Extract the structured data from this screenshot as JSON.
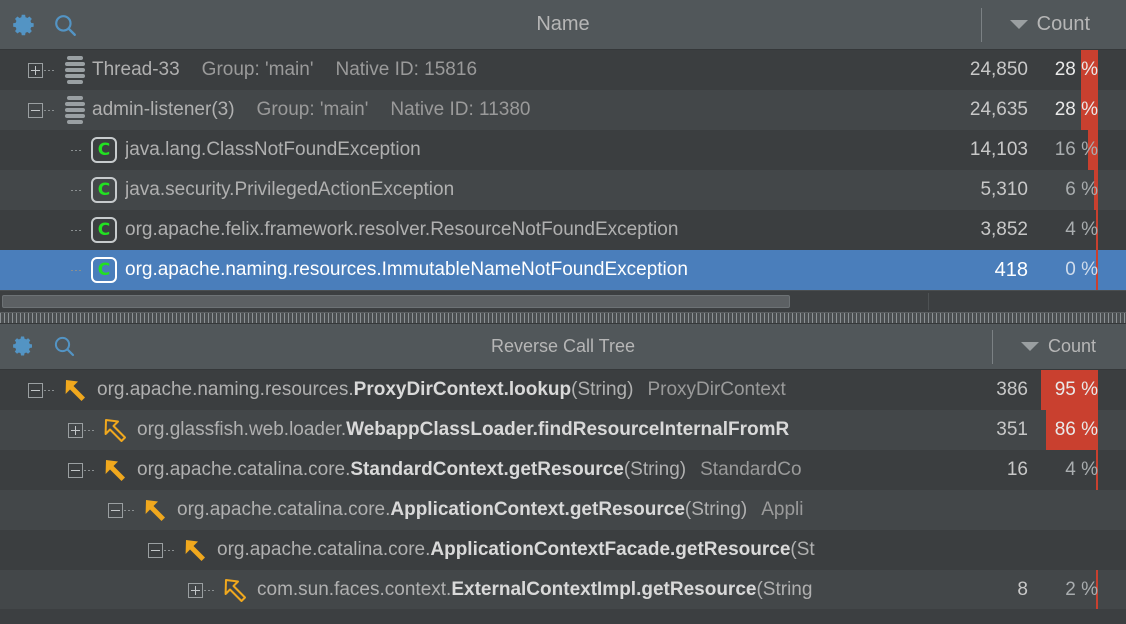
{
  "top_panel": {
    "header": {
      "gear_icon": "gear-icon",
      "search_icon": "search-icon",
      "title": "Name",
      "sort_caret": "chevron-down-icon",
      "count_label": "Count"
    },
    "rows": [
      {
        "kind": "thread",
        "indent": 0,
        "toggle": "plus",
        "icon": "thread-stack-icon",
        "name": "Thread-33",
        "group": "Group: 'main'",
        "native": "Native ID: 15816",
        "count": "24,850",
        "pct_text": "28 %",
        "pct_value": 28,
        "selected": false
      },
      {
        "kind": "thread",
        "indent": 0,
        "toggle": "minus",
        "icon": "thread-stack-icon",
        "name": "admin-listener(3)",
        "group": "Group: 'main'",
        "native": "Native ID: 11380",
        "count": "24,635",
        "pct_text": "28 %",
        "pct_value": 28,
        "selected": false
      },
      {
        "kind": "class",
        "indent": 1,
        "toggle": "none",
        "icon": "class-icon",
        "name": "java.lang.ClassNotFoundException",
        "count": "14,103",
        "pct_text": "16 %",
        "pct_value": 16,
        "selected": false
      },
      {
        "kind": "class",
        "indent": 1,
        "toggle": "none",
        "icon": "class-icon",
        "name": "java.security.PrivilegedActionException",
        "count": "5,310",
        "pct_text": "6 %",
        "pct_value": 6,
        "selected": false
      },
      {
        "kind": "class",
        "indent": 1,
        "toggle": "none",
        "icon": "class-icon",
        "name": "org.apache.felix.framework.resolver.ResourceNotFoundException",
        "count": "3,852",
        "pct_text": "4 %",
        "pct_value": 4,
        "selected": false
      },
      {
        "kind": "class",
        "indent": 1,
        "toggle": "none",
        "icon": "class-icon",
        "name": "org.apache.naming.resources.ImmutableNameNotFoundException",
        "count": "418",
        "pct_text": "0 %",
        "pct_value": 0,
        "selected": true
      }
    ],
    "scrollbar": {
      "name": "horizontal-scrollbar"
    }
  },
  "bottom_panel": {
    "header": {
      "gear_icon": "gear-icon",
      "search_icon": "search-icon",
      "title": "Reverse Call Tree",
      "sort_caret": "chevron-down-icon",
      "count_label": "Count"
    },
    "rows": [
      {
        "indent": 0,
        "toggle": "minus",
        "icon": "call-arrow-filled-icon",
        "pkg": "org.apache.naming.resources.",
        "bold": "ProxyDirContext.lookup",
        "sig": "(String)",
        "tail": "ProxyDirContext",
        "count": "386",
        "pct_text": "95 %",
        "pct_value": 95
      },
      {
        "indent": 1,
        "toggle": "plus",
        "icon": "call-arrow-outline-icon",
        "pkg": "org.glassfish.web.loader.",
        "bold": "WebappClassLoader.findResourceInternalFromR",
        "sig": "",
        "tail": "",
        "count": "351",
        "pct_text": "86 %",
        "pct_value": 86
      },
      {
        "indent": 1,
        "toggle": "minus",
        "icon": "call-arrow-filled-icon",
        "pkg": "org.apache.catalina.core.",
        "bold": "StandardContext.getResource",
        "sig": "(String)",
        "tail": "StandardCo",
        "count": "16",
        "pct_text": "4 %",
        "pct_value": 4
      },
      {
        "indent": 2,
        "toggle": "minus",
        "icon": "call-arrow-filled-icon",
        "pkg": "org.apache.catalina.core.",
        "bold": "ApplicationContext.getResource",
        "sig": "(String)",
        "tail": "Appli",
        "count": "",
        "pct_text": "",
        "pct_value": 0
      },
      {
        "indent": 3,
        "toggle": "minus",
        "icon": "call-arrow-filled-icon",
        "pkg": "org.apache.catalina.core.",
        "bold": "ApplicationContextFacade.getResource",
        "sig": "(St",
        "tail": "",
        "count": "",
        "pct_text": "",
        "pct_value": 0
      },
      {
        "indent": 4,
        "toggle": "plus",
        "icon": "call-arrow-outline-icon",
        "pkg": "com.sun.faces.context.",
        "bold": "ExternalContextImpl.getResource",
        "sig": "(String",
        "tail": "",
        "count": "8",
        "pct_text": "2 %",
        "pct_value": 2
      }
    ]
  },
  "colors": {
    "accent_red": "#c9402f",
    "selection_blue": "#4a7ebb",
    "icon_blue": "#5394c4",
    "class_green": "#22e022",
    "arrow_orange": "#f0a81e",
    "panel_bg": "#3c3f41",
    "header_bg": "#51575a"
  }
}
